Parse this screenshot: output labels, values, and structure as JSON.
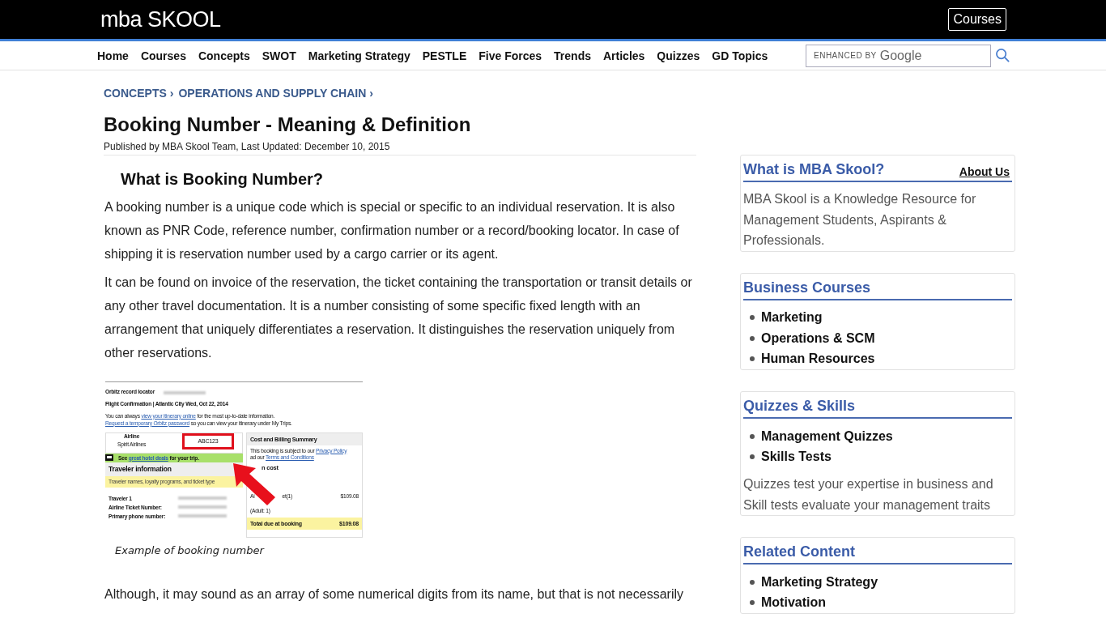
{
  "header": {
    "logo": "mba SKOOL",
    "courses_button": "Courses"
  },
  "nav": {
    "items": [
      "Home",
      "Courses",
      "Concepts",
      "SWOT",
      "Marketing Strategy",
      "PESTLE",
      "Five Forces",
      "Trends",
      "Articles",
      "Quizzes",
      "GD Topics"
    ],
    "search": {
      "branding_label": "ENHANCED BY",
      "branding_name": "Google"
    }
  },
  "breadcrumb": {
    "separator": "›",
    "items": [
      "CONCEPTS",
      "OPERATIONS AND SUPPLY CHAIN"
    ]
  },
  "article": {
    "title": "Booking Number - Meaning & Definition",
    "byline": "Published by MBA Skool Team, Last Updated: December 10, 2015",
    "heading": "What is Booking Number?",
    "paragraphs": [
      "A booking number is a unique code which is special or specific to an individual reservation. It is also known as PNR Code, reference number, confirmation number or a record/booking locator. In case of shipping it is reservation number used by a cargo carrier or its agent.",
      "It can be found on invoice of the reservation, the ticket containing the transportation or transit details or any other travel documentation. It is a number consisting of some specific fixed length with an arrangement that uniquely differentiates a reservation. It distinguishes the reservation uniquely from other reservations."
    ],
    "figure": {
      "doc": {
        "locator_label": "Orbitz record locator",
        "confirmation": "Flight Confirmation | Atlantic City Wed, Oct 22, 2014",
        "itinerary_line": {
          "before": "You can always",
          "link": "view your itinerary online",
          "after": "for the most up-to-date information."
        },
        "password_line": {
          "link": "Request a temporary Orbitz password",
          "after": "so you can view your itinerary under My Trips."
        },
        "airline_header": "Airline",
        "airline": "Spirit Airlines",
        "booking_code": "ABC123",
        "hotel_bar": {
          "before": "See",
          "link": "great hotel deals",
          "after": "for your trip."
        },
        "traveler_heading": "Traveler information",
        "traveler_note": "Traveler names, loyalty programs, and ticket type",
        "traveler_fields": [
          "Traveler 1",
          "Airline Ticket Number:",
          "Primary phone number:"
        ],
        "cost_heading": "Cost and Billing Summary",
        "policy_line": {
          "before": "This booking is subject to our",
          "link": "Privacy Policy"
        },
        "terms_line": {
          "before": "ad our",
          "link": "Terms and Conditions"
        },
        "cost_label": "n cost",
        "fare_start": "Ai",
        "fare_end": "et(1)",
        "fare_amount": "$109.08",
        "adult": "(Adult: 1)",
        "total_label": "Total due at booking",
        "total": "$109.08"
      },
      "caption": "Example of booking number"
    },
    "closing_paragraph": "Although, it may sound as an array of some numerical digits from its name, but that is not necessarily"
  },
  "sidebar": [
    {
      "kind": "text",
      "title": "What is MBA Skool?",
      "link": "About Us",
      "text": "MBA Skool is a Knowledge Resource for Management Students, Aspirants & Professionals."
    },
    {
      "kind": "list",
      "title": "Business Courses",
      "items": [
        "Marketing",
        "Operations & SCM",
        "Human Resources"
      ]
    },
    {
      "kind": "list",
      "title": "Quizzes & Skills",
      "items": [
        "Management Quizzes",
        "Skills Tests"
      ],
      "text": "Quizzes test your expertise in business and Skill tests evaluate your management traits"
    },
    {
      "kind": "list",
      "title": "Related Content",
      "items": [
        "Marketing Strategy",
        "Motivation"
      ]
    }
  ]
}
